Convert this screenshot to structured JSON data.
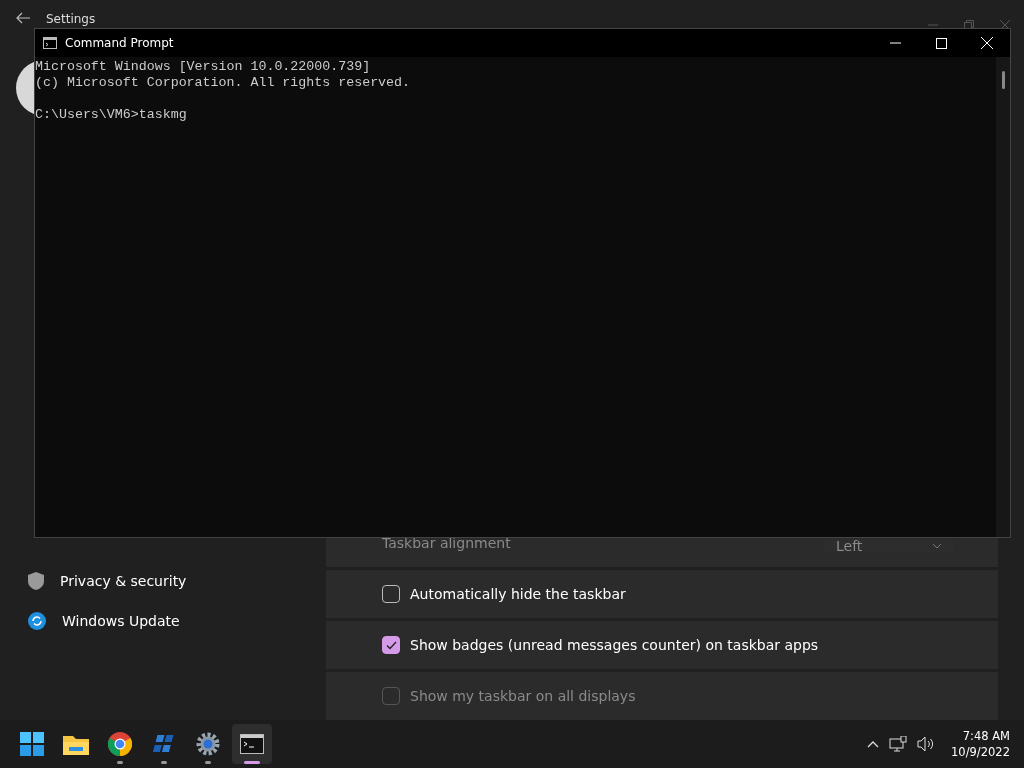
{
  "settings_window": {
    "title": "Settings",
    "sidebar": {
      "items": [
        {
          "kind": "shield",
          "label": "Privacy & security"
        },
        {
          "kind": "update",
          "label": "Windows Update"
        }
      ]
    },
    "rows": [
      {
        "kind": "dropdown",
        "label": "Taskbar alignment",
        "value": "Left",
        "disabled": true
      },
      {
        "kind": "checkbox",
        "label": "Automatically hide the taskbar",
        "checked": false,
        "disabled": false
      },
      {
        "kind": "checkbox",
        "label": "Show badges (unread messages counter) on taskbar apps",
        "checked": true,
        "disabled": false
      },
      {
        "kind": "checkbox",
        "label": "Show my taskbar on all displays",
        "checked": false,
        "disabled": true
      }
    ]
  },
  "console_window": {
    "title": "Command Prompt",
    "paragraphs": [
      [
        "Microsoft Windows [Version 10.0.22000.739]",
        "(c) Microsoft Corporation. All rights reserved."
      ],
      [
        "C:\\Users\\VM6>taskmg"
      ]
    ]
  },
  "taskbar": {
    "apps": [
      {
        "kind": "start",
        "running": false,
        "active": false
      },
      {
        "kind": "folder",
        "running": false,
        "active": false
      },
      {
        "kind": "browser",
        "running": true,
        "active": false
      },
      {
        "kind": "grid",
        "running": true,
        "active": false
      },
      {
        "kind": "gear",
        "running": true,
        "active": false
      },
      {
        "kind": "terminal",
        "running": true,
        "active": true
      }
    ],
    "clock": {
      "time": "7:48 AM",
      "date": "10/9/2022"
    }
  }
}
